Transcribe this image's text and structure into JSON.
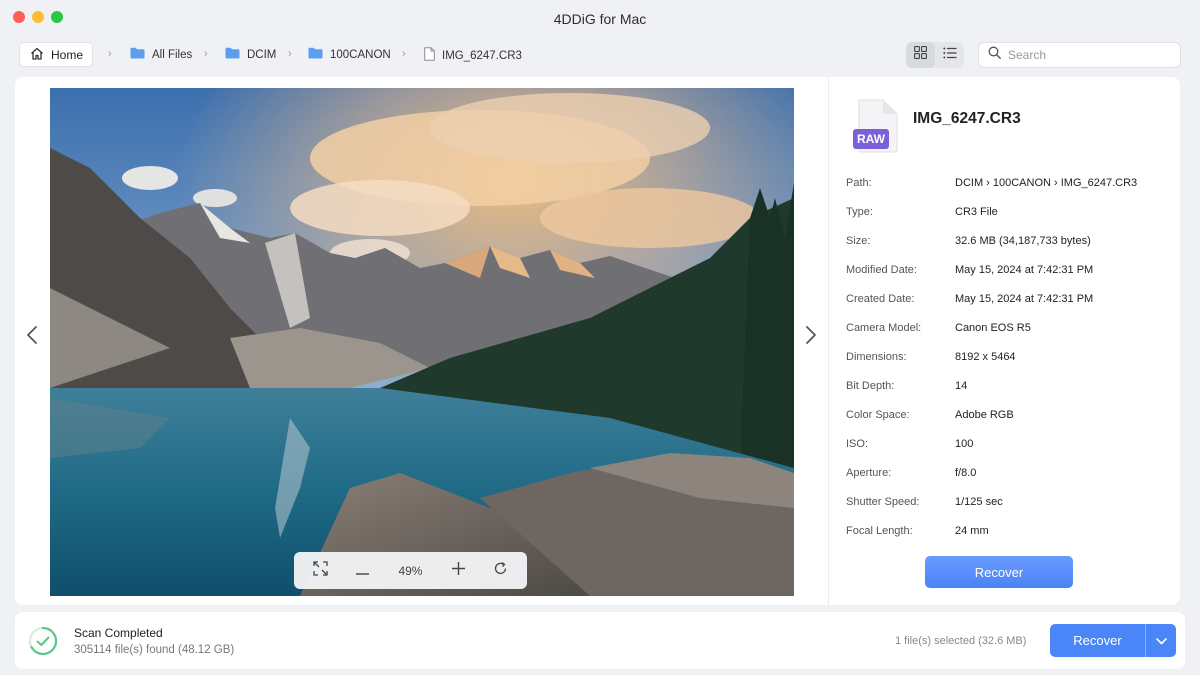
{
  "window": {
    "title": "4DDiG for Mac"
  },
  "toolbar": {
    "home_label": "Home",
    "breadcrumbs": [
      {
        "label": "All Files",
        "icon": "folder-icon"
      },
      {
        "label": "DCIM",
        "icon": "folder-icon"
      },
      {
        "label": "100CANON",
        "icon": "folder-icon"
      },
      {
        "label": "IMG_6247.CR3",
        "icon": "file-icon"
      }
    ],
    "view_mode": "list",
    "search_placeholder": "Search"
  },
  "preview": {
    "zoom": "49%",
    "image_description": "mountain-lake-landscape"
  },
  "details": {
    "file_name": "IMG_6247.CR3",
    "file_badge": "RAW",
    "rows": [
      {
        "label": "Path:",
        "value": "DCIM › 100CANON › IMG_6247.CR3"
      },
      {
        "label": "Type:",
        "value": "CR3 File"
      },
      {
        "label": "Size:",
        "value": "32.6 MB (34,187,733 bytes)"
      },
      {
        "label": "Modified Date:",
        "value": "May 15, 2024 at 7:42:31 PM"
      },
      {
        "label": "Created Date:",
        "value": "May 15, 2024 at 7:42:31 PM"
      },
      {
        "label": "Camera Model:",
        "value": "Canon EOS R5"
      },
      {
        "label": "Dimensions:",
        "value": "8192 x 5464"
      },
      {
        "label": "Bit Depth:",
        "value": "14"
      },
      {
        "label": "Color Space:",
        "value": "Adobe RGB"
      },
      {
        "label": "ISO:",
        "value": "100"
      },
      {
        "label": "Aperture:",
        "value": "f/8.0"
      },
      {
        "label": "Shutter Speed:",
        "value": "1/125 sec"
      },
      {
        "label": "Focal Length:",
        "value": "24 mm"
      }
    ],
    "recover_label": "Recover"
  },
  "footer": {
    "scan_title": "Scan Completed",
    "scan_subtitle": "305114 file(s) found (48.12 GB)",
    "selected_info": "1 file(s) selected (32.6 MB)",
    "recover_label": "Recover"
  },
  "colors": {
    "accent": "#4a86f7",
    "badge": "#7b61d9",
    "folder": "#5b9ef0",
    "scan_ok": "#5cc58a"
  }
}
